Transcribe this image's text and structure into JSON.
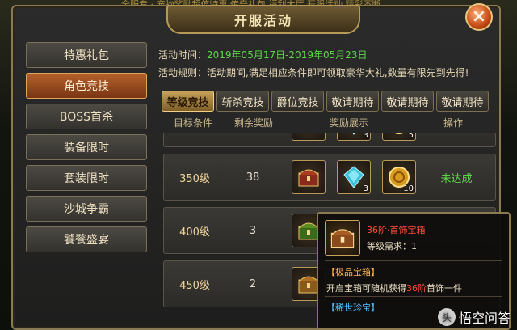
{
  "ticker": "全服专 · 宠物奖励超值特惠 传奇礼包 福利大厅 开服活动 精彩不断",
  "title": "开服活动",
  "close_label": "×",
  "sidebar": {
    "items": [
      {
        "label": "特惠礼包",
        "active": false
      },
      {
        "label": "角色竞技",
        "active": true
      },
      {
        "label": "BOSS首杀",
        "active": false
      },
      {
        "label": "装备限时",
        "active": false
      },
      {
        "label": "套装限时",
        "active": false
      },
      {
        "label": "沙城争霸",
        "active": false
      },
      {
        "label": "饕餮盛宴",
        "active": false
      }
    ]
  },
  "info": {
    "time_label": "活动时间：",
    "time_value": "2019年05月17日-2019年05月23日",
    "rule_label": "活动规则：",
    "rule_text": "活动期间,满足相应条件即可领取豪华大礼,数量有限先到先得!"
  },
  "tabs": [
    {
      "label": "等级竞技",
      "active": true
    },
    {
      "label": "斩杀竞技",
      "active": false
    },
    {
      "label": "爵位竞技",
      "active": false
    },
    {
      "label": "敬请期待",
      "active": false
    },
    {
      "label": "敬请期待",
      "active": false
    },
    {
      "label": "敬请期待",
      "active": false
    }
  ],
  "columns": {
    "condition": "目标条件",
    "remaining": "剩余奖励",
    "rewards": "奖励展示",
    "action": "操作"
  },
  "rows": [
    {
      "level": "",
      "remaining": "",
      "status": "",
      "items": [
        {
          "icon": "chest-icon",
          "count": ""
        },
        {
          "icon": "crystal-icon",
          "count": "3"
        },
        {
          "icon": "coin-icon",
          "count": "5"
        }
      ]
    },
    {
      "level": "350级",
      "remaining": "38",
      "status": "未达成",
      "items": [
        {
          "icon": "chest-icon",
          "count": ""
        },
        {
          "icon": "crystal-icon",
          "count": "3"
        },
        {
          "icon": "coin-icon",
          "count": "10"
        }
      ]
    },
    {
      "level": "400级",
      "remaining": "3",
      "status": "",
      "items": [
        {
          "icon": "chest-icon",
          "count": ""
        }
      ]
    },
    {
      "level": "450级",
      "remaining": "2",
      "status": "",
      "items": [
        {
          "icon": "chest-icon",
          "count": ""
        }
      ]
    }
  ],
  "tooltip": {
    "name": "36阶·首饰宝箱",
    "req_label": "等级需求：1",
    "category1": "【极品宝箱】",
    "desc_prefix": "开启宝箱可随机获得",
    "desc_highlight": "36阶",
    "desc_suffix": "首饰一件",
    "category2": "【稀世珍宝】"
  },
  "watermark": {
    "logo": "头",
    "text": "悟空问答"
  },
  "colors": {
    "accent": "#c7a25b",
    "active_side": "#b4612a",
    "success": "#5ed64a",
    "rare": "#ff4b3b"
  }
}
